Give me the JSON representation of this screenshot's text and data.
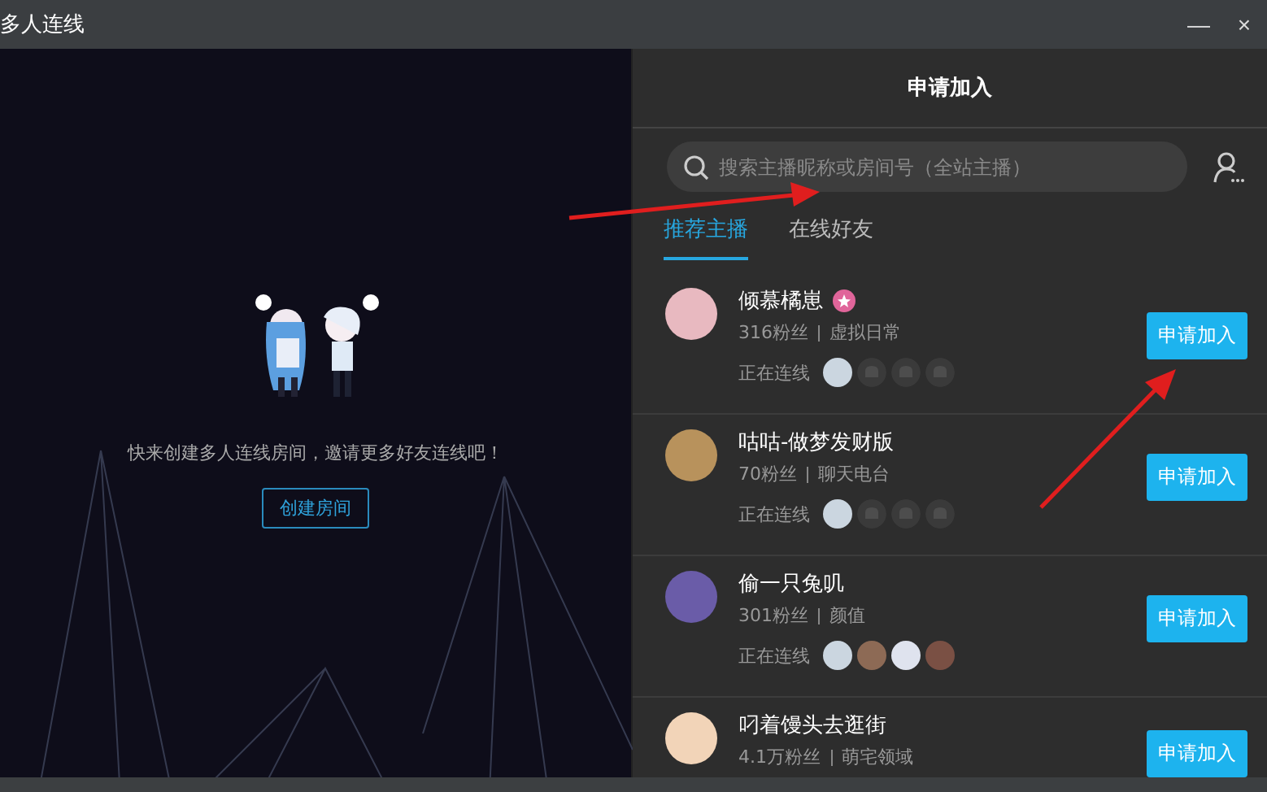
{
  "window": {
    "title": "多人连线",
    "minimize": "—",
    "close": "×"
  },
  "left_panel": {
    "message": "快来创建多人连线房间，邀请更多好友连线吧！",
    "create_button": "创建房间"
  },
  "right_panel": {
    "title": "申请加入",
    "search": {
      "placeholder": "搜索主播昵称或房间号（全站主播）"
    },
    "tabs": [
      {
        "label": "推荐主播",
        "selected": true
      },
      {
        "label": "在线好友",
        "selected": false
      }
    ],
    "streamers": [
      {
        "name": "倾慕橘崽",
        "badge": true,
        "fans": "316粉丝",
        "category": "虚拟日常",
        "status": "正在连线",
        "guests": [
          {
            "kind": "avatar"
          },
          {
            "kind": "empty"
          },
          {
            "kind": "empty"
          },
          {
            "kind": "empty"
          }
        ],
        "button": "申请加入"
      },
      {
        "name": "咕咕-做梦发财版",
        "badge": false,
        "fans": "70粉丝",
        "category": "聊天电台",
        "status": "正在连线",
        "guests": [
          {
            "kind": "avatar"
          },
          {
            "kind": "empty"
          },
          {
            "kind": "empty"
          },
          {
            "kind": "empty"
          }
        ],
        "button": "申请加入"
      },
      {
        "name": "偷一只兔叽",
        "badge": false,
        "fans": "301粉丝",
        "category": "颜值",
        "status": "正在连线",
        "guests": [
          {
            "kind": "avatar"
          },
          {
            "kind": "avatar"
          },
          {
            "kind": "avatar"
          },
          {
            "kind": "avatar"
          }
        ],
        "button": "申请加入"
      },
      {
        "name": "叼着馒头去逛街",
        "badge": false,
        "fans": "4.1万粉丝",
        "category": "萌宅领域",
        "button": "申请加入"
      }
    ]
  }
}
